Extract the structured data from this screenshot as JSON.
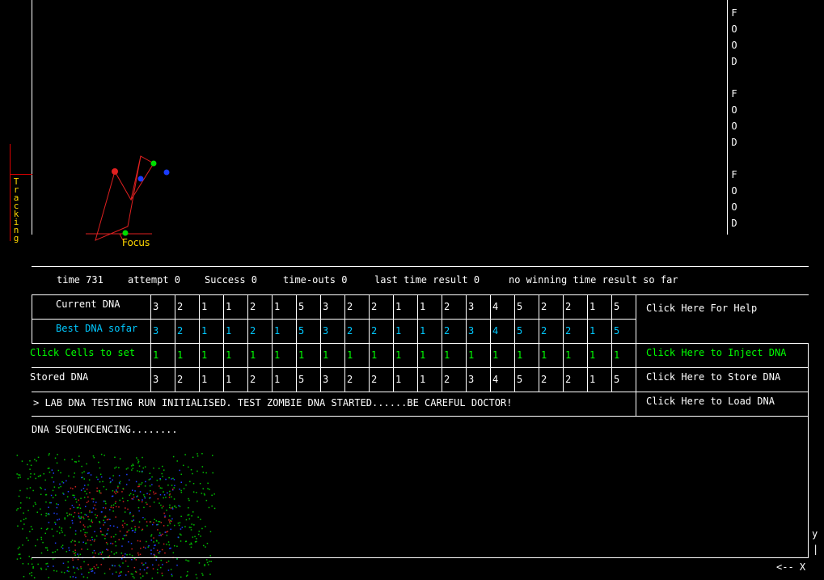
{
  "food_labels": [
    "F",
    "O",
    "O",
    "D",
    "",
    "F",
    "O",
    "O",
    "D",
    "",
    "F",
    "O",
    "O",
    "D"
  ],
  "tracking_label": "Tracking",
  "focus_label": "Focus",
  "status": {
    "time": "time 731",
    "attempt": "attempt 0",
    "success": "Success 0",
    "timeouts": "time-outs 0",
    "last_result": "last time result 0",
    "winning": "no winning time result so far"
  },
  "rows": {
    "current": {
      "label": "Current DNA",
      "values": [
        "3",
        "2",
        "1",
        "1",
        "2",
        "1",
        "5",
        "3",
        "2",
        "2",
        "1",
        "1",
        "2",
        "3",
        "4",
        "5",
        "2",
        "2",
        "1",
        "5"
      ]
    },
    "best": {
      "label": "Best DNA sofar",
      "values": [
        "3",
        "2",
        "1",
        "1",
        "2",
        "1",
        "5",
        "3",
        "2",
        "2",
        "1",
        "1",
        "2",
        "3",
        "4",
        "5",
        "2",
        "2",
        "1",
        "5"
      ]
    },
    "set": {
      "label": "Click Cells to set",
      "values": [
        "1",
        "1",
        "1",
        "1",
        "1",
        "1",
        "1",
        "1",
        "1",
        "1",
        "1",
        "1",
        "1",
        "1",
        "1",
        "1",
        "1",
        "1",
        "1",
        "1"
      ]
    },
    "stored": {
      "label": "Stored DNA",
      "values": [
        "3",
        "2",
        "1",
        "1",
        "2",
        "1",
        "5",
        "3",
        "2",
        "2",
        "1",
        "1",
        "2",
        "3",
        "4",
        "5",
        "2",
        "2",
        "1",
        "5"
      ]
    }
  },
  "buttons": {
    "help": "Click Here For Help",
    "inject": "Click Here to Inject DNA",
    "store": "Click Here to Store DNA",
    "load": "Click Here to Load DNA"
  },
  "message": "> LAB DNA TESTING RUN INITIALISED. TEST ZOMBIE DNA STARTED......BE CAREFUL DOCTOR!",
  "sequencing": "DNA SEQUENCENCING........",
  "corner": {
    "y_label": "y",
    "bar": "|",
    "arrow_label": "<-- X"
  },
  "colors": {
    "current": "#ffffff",
    "best": "#00c8ff",
    "set": "#00ff00",
    "stored": "#ffffff",
    "accent": "#ffd700"
  }
}
